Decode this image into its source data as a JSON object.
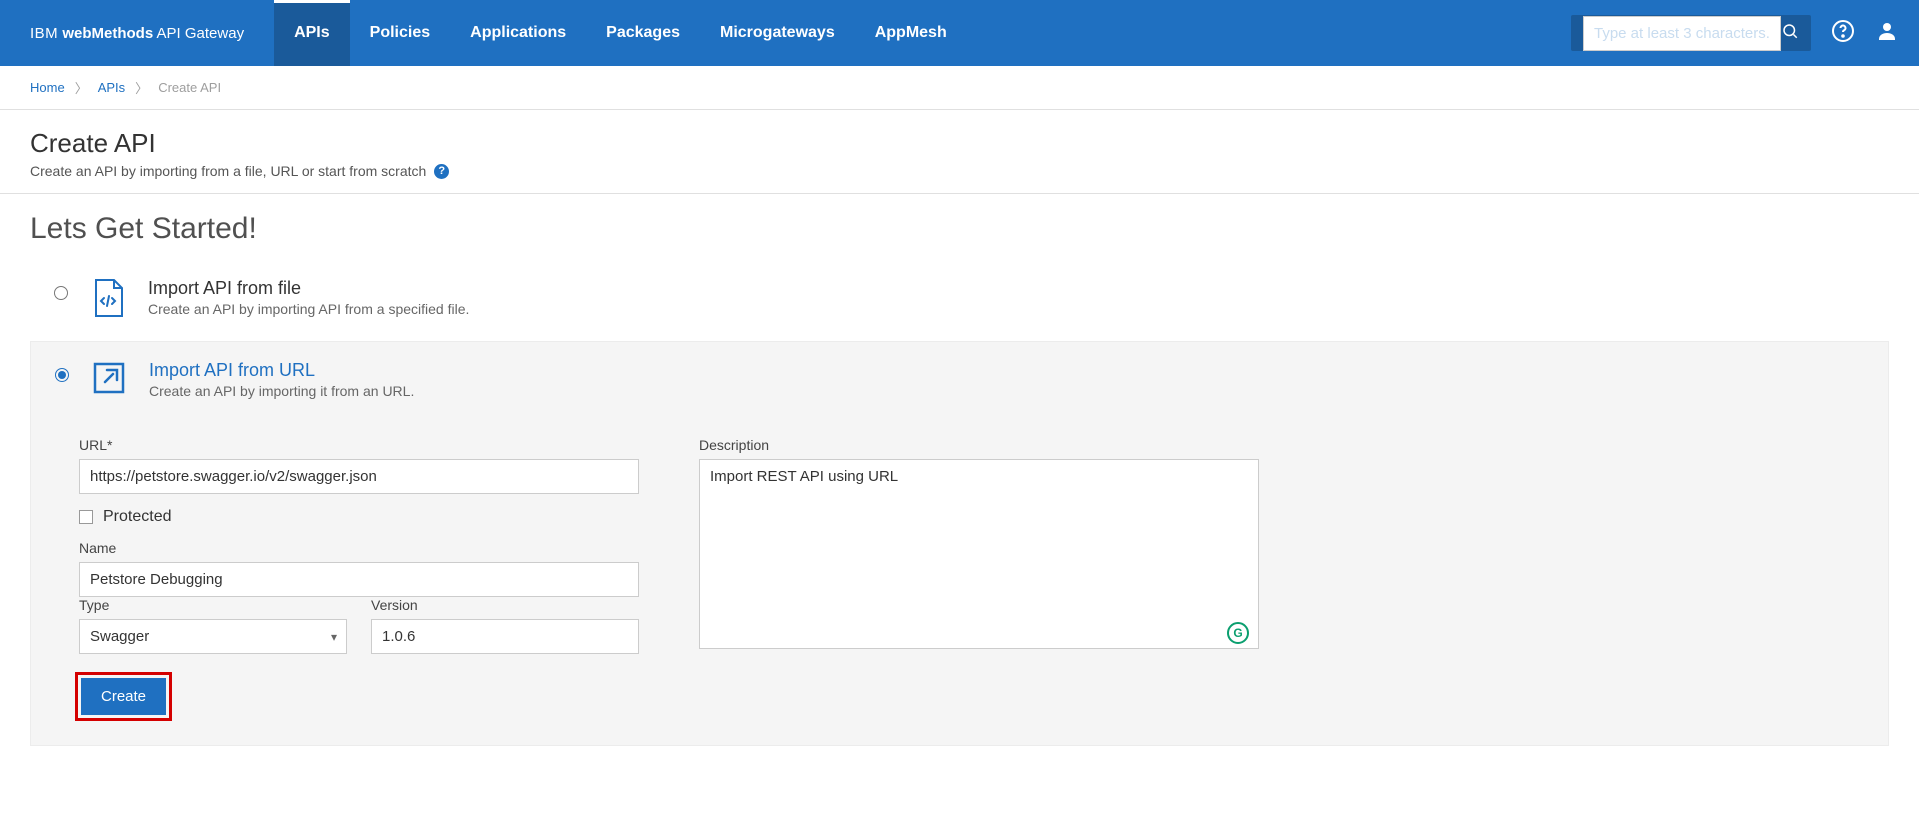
{
  "brand": {
    "ibm": "IBM",
    "wm": "webMethods",
    "gw": "API Gateway"
  },
  "tabs": [
    {
      "label": "APIs",
      "active": true
    },
    {
      "label": "Policies",
      "active": false
    },
    {
      "label": "Applications",
      "active": false
    },
    {
      "label": "Packages",
      "active": false
    },
    {
      "label": "Microgateways",
      "active": false
    },
    {
      "label": "AppMesh",
      "active": false
    }
  ],
  "search": {
    "placeholder": "Type at least 3 characters."
  },
  "breadcrumb": {
    "home": "Home",
    "apis": "APIs",
    "current": "Create API"
  },
  "page": {
    "title": "Create API",
    "subtitle": "Create an API by importing from a file, URL or start from scratch"
  },
  "lead": "Lets Get Started!",
  "options": {
    "file": {
      "title": "Import API from file",
      "desc": "Create an API by importing API from a specified file."
    },
    "url": {
      "title": "Import API from URL",
      "desc": "Create an API by importing it from an URL."
    }
  },
  "form": {
    "url_label": "URL*",
    "url_value": "https://petstore.swagger.io/v2/swagger.json",
    "protected_label": "Protected",
    "name_label": "Name",
    "name_value": "Petstore Debugging",
    "type_label": "Type",
    "type_value": "Swagger",
    "version_label": "Version",
    "version_value": "1.0.6",
    "desc_label": "Description",
    "desc_value": "Import REST API using URL"
  },
  "buttons": {
    "create": "Create"
  }
}
